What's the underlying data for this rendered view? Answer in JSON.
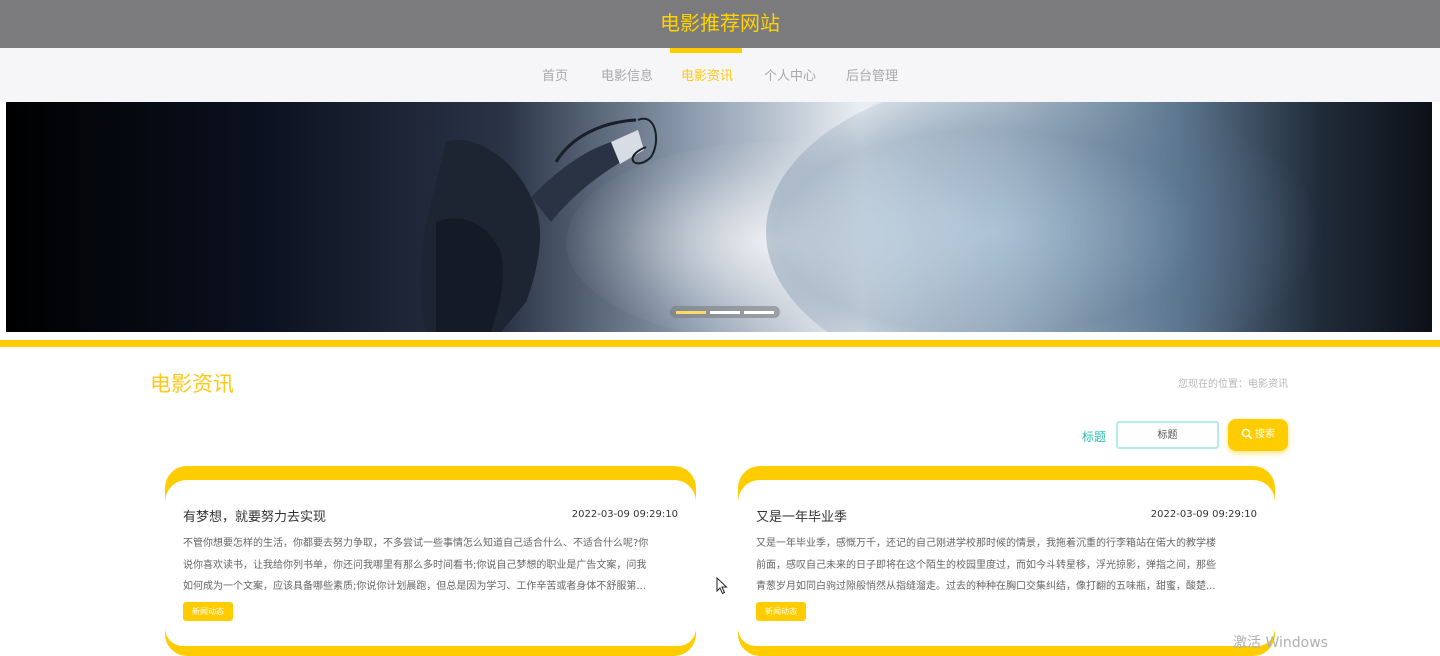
{
  "header": {
    "site_title": "电影推荐网站"
  },
  "nav": {
    "items": [
      "首页",
      "电影信息",
      "电影资讯",
      "个人中心",
      "后台管理"
    ],
    "active_index": 2
  },
  "carousel": {
    "slide_count": 3,
    "active_index": 0
  },
  "section": {
    "title": "电影资讯",
    "breadcrumb": "您现在的位置：电影资讯"
  },
  "search": {
    "label": "标题",
    "placeholder": "标题",
    "button_label": "搜索"
  },
  "news": [
    {
      "title": "有梦想，就要努力去实现",
      "date": "2022-03-09 09:29:10",
      "excerpt_lines": [
        "不管你想要怎样的生活，你都要去努力争取，不多尝试一些事情怎么知道自己适合什么、不适合什么呢?你",
        "说你喜欢读书，让我给你列书单，你还问我哪里有那么多时间看书;你说自己梦想的职业是广告文案，问我",
        "如何成为一个文案，应该具备哪些素质;你说你计划晨跑，但总是因为学习、工作辛苦或者身体不舒服第..."
      ],
      "tag": "新闻动态"
    },
    {
      "title": "又是一年毕业季",
      "date": "2022-03-09 09:29:10",
      "excerpt_lines": [
        "又是一年毕业季，感慨万千，还记的自己刚进学校那时候的情景，我拖着沉重的行李箱站在偌大的教学楼",
        "前面，感叹自己未来的日子即将在这个陌生的校园里度过，而如今斗转星移，浮光掠影，弹指之间，那些",
        "青葱岁月如同白驹过隙般悄然从指缝溜走。过去的种种在胸口交集纠结，像打翻的五味瓶，甜蜜，酸楚..."
      ],
      "tag": "新闻动态"
    }
  ],
  "os": {
    "watermark": "激活 Windows"
  },
  "colors": {
    "accent": "#ffcc00",
    "header_bg": "#7b7b7d",
    "nav_bg": "#f6f5f8",
    "search_label": "#2bc0b6"
  }
}
